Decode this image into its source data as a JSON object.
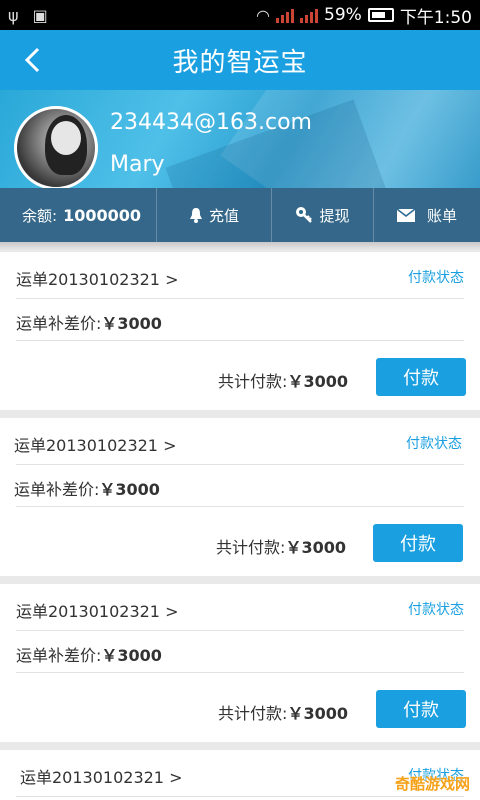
{
  "status_bar": {
    "battery": "59%",
    "time": "下午1:50"
  },
  "header": {
    "title": "我的智运宝"
  },
  "profile": {
    "email": "234434@163.com",
    "name": "Mary"
  },
  "account_bar": {
    "balance_label": "余额:",
    "balance_value": "1000000",
    "recharge_label": "充值",
    "withdraw_label": "提现",
    "bill_label": "账单"
  },
  "orders": [
    {
      "order_label": "运单20130102321 >",
      "status_label": "付款状态",
      "supplement_label": "运单补差价:",
      "supplement_amount": "￥3000",
      "total_label": "共计付款:",
      "total_amount": "￥3000",
      "pay_label": "付款"
    },
    {
      "order_label": "运单20130102321 >",
      "status_label": "付款状态",
      "supplement_label": "运单补差价:",
      "supplement_amount": "￥3000",
      "total_label": "共计付款:",
      "total_amount": "￥3000",
      "pay_label": "付款"
    },
    {
      "order_label": "运单20130102321 >",
      "status_label": "付款状态",
      "supplement_label": "运单补差价:",
      "supplement_amount": "￥3000",
      "total_label": "共计付款:",
      "total_amount": "￥3000",
      "pay_label": "付款"
    },
    {
      "order_label": "运单20130102321 >",
      "status_label": "付款状态"
    }
  ],
  "watermark": "奇酷游戏网",
  "colors": {
    "accent": "#1a9fe0",
    "header": "#1a9fe0"
  }
}
